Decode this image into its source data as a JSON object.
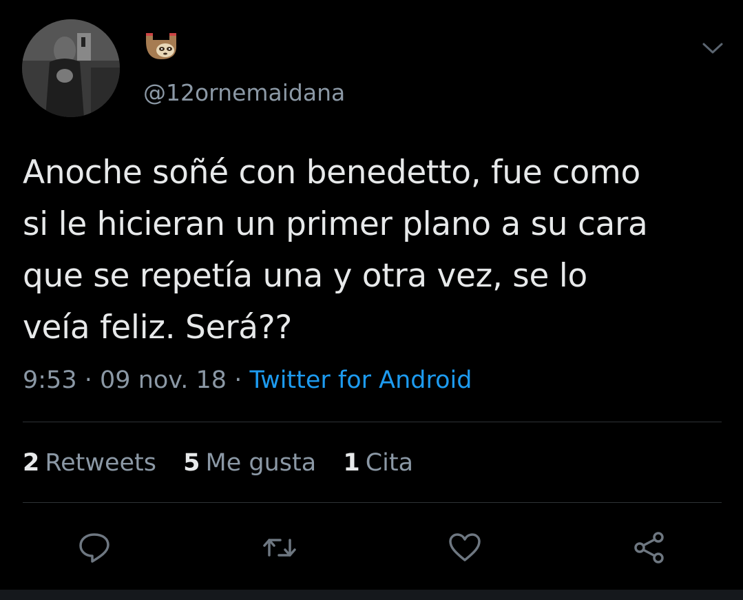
{
  "tweet": {
    "username": "@12ornemaidana",
    "text": "Anoche soñé con benedetto, fue como\nsi le hicieran un primer plano a su cara\nque se repetía una y otra vez, se lo\nveía feliz. Será??",
    "time": "9:53",
    "date": "09 nov. 18",
    "separator": "·",
    "source": "Twitter for Android"
  },
  "stats": {
    "retweets_count": "2",
    "retweets_label": "Retweets",
    "likes_count": "5",
    "likes_label": "Me gusta",
    "quotes_count": "1",
    "quotes_label": "Cita"
  },
  "icons": {
    "display_name": "sloth-emoji-icon",
    "menu": "chevron-down-icon",
    "reply": "reply-icon",
    "retweet": "retweet-icon",
    "like": "heart-icon",
    "share": "share-icon"
  },
  "colors": {
    "background": "#000000",
    "text": "#e7e9ea",
    "secondary": "#8b98a5",
    "link": "#1d9bf0",
    "divider": "#2f3336"
  }
}
